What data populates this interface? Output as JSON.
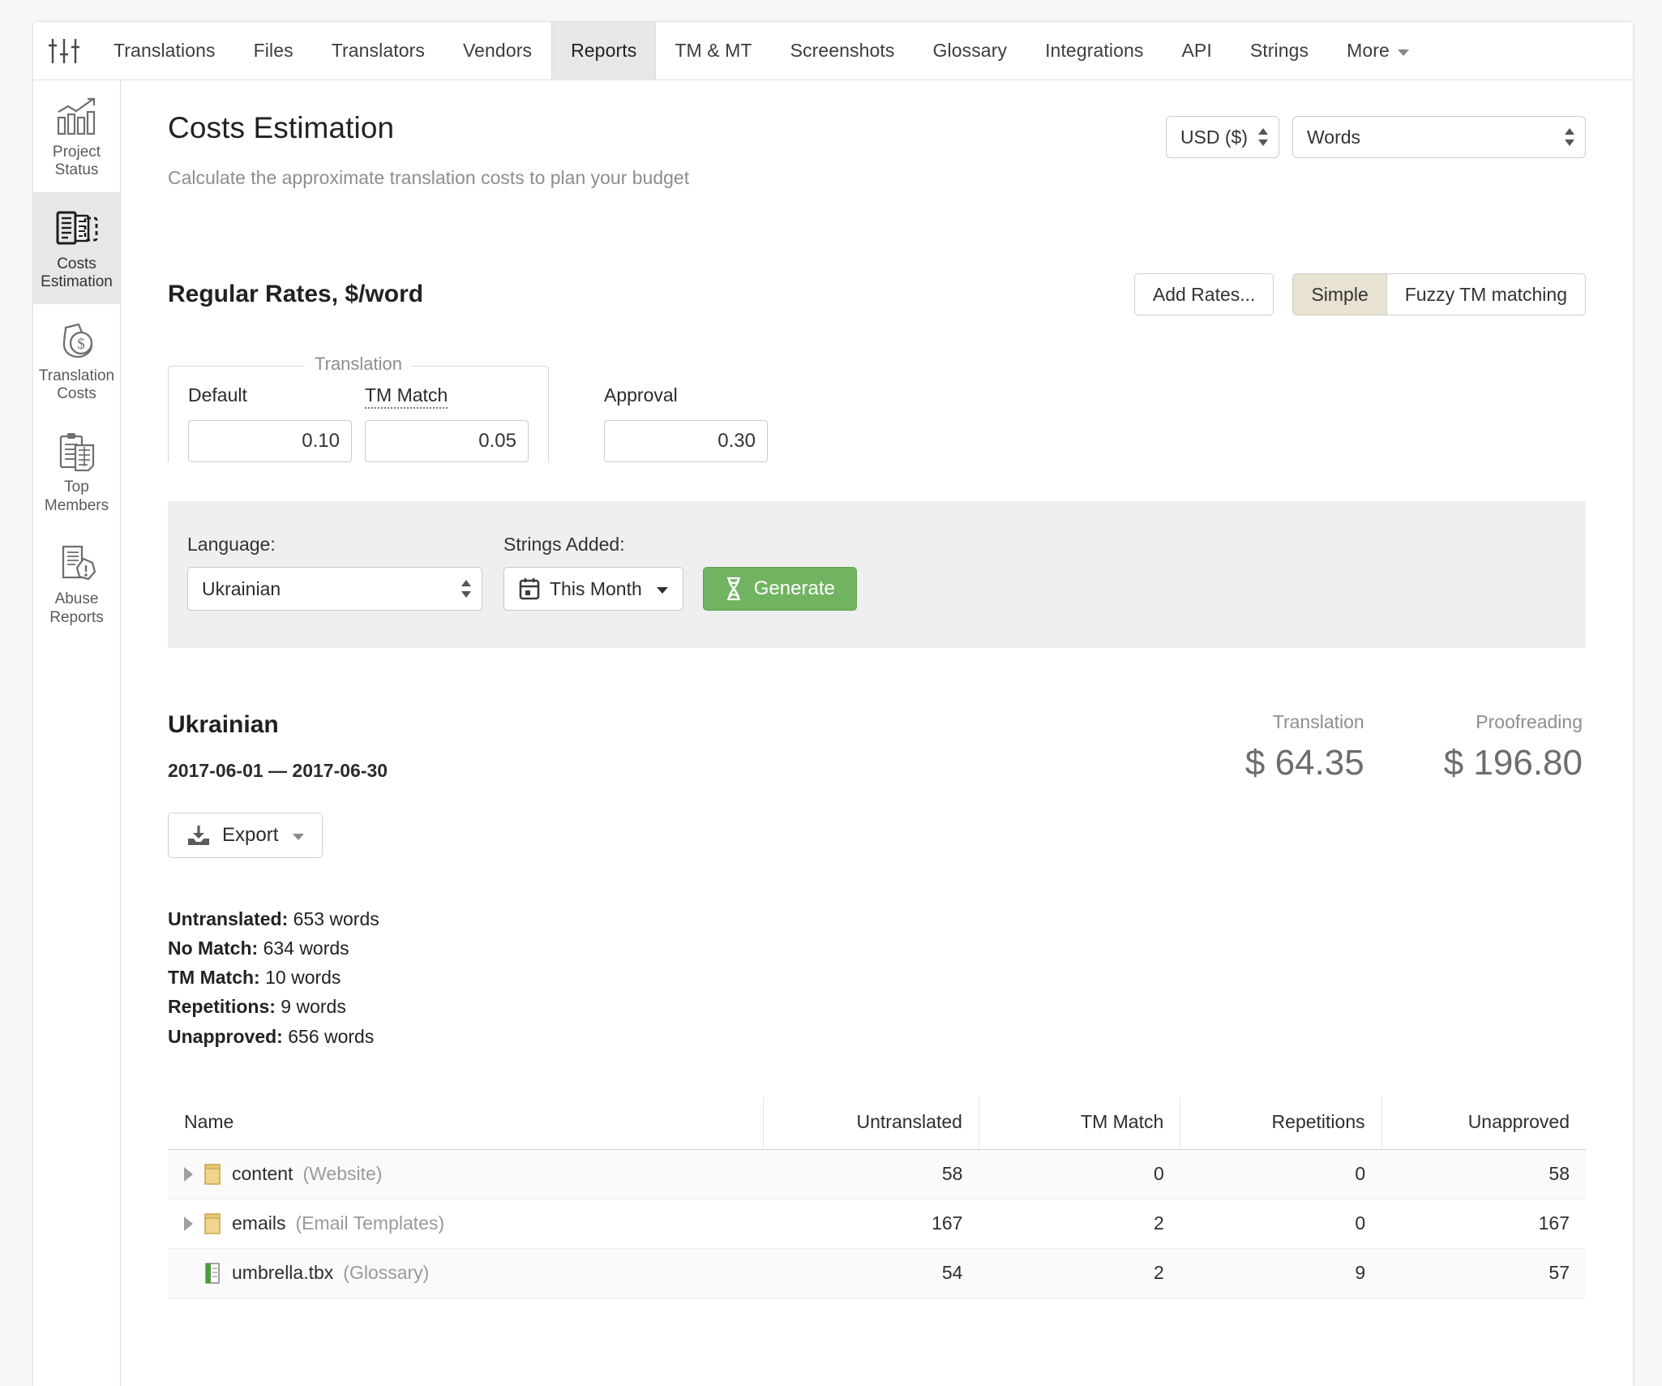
{
  "nav": {
    "logo_icon": "sliders-icon",
    "items": [
      {
        "label": "Translations",
        "active": false
      },
      {
        "label": "Files",
        "active": false
      },
      {
        "label": "Translators",
        "active": false
      },
      {
        "label": "Vendors",
        "active": false
      },
      {
        "label": "Reports",
        "active": true
      },
      {
        "label": "TM & MT",
        "active": false
      },
      {
        "label": "Screenshots",
        "active": false
      },
      {
        "label": "Glossary",
        "active": false
      },
      {
        "label": "Integrations",
        "active": false
      },
      {
        "label": "API",
        "active": false
      },
      {
        "label": "Strings",
        "active": false
      }
    ],
    "more_label": "More"
  },
  "sidebar": {
    "items": [
      {
        "label_1": "Project",
        "label_2": "Status",
        "icon": "bar-chart-growth-icon",
        "active": false
      },
      {
        "label_1": "Costs",
        "label_2": "Estimation",
        "icon": "documents-estimate-icon",
        "active": true
      },
      {
        "label_1": "Translation",
        "label_2": "Costs",
        "icon": "money-bag-dollar-icon",
        "active": false
      },
      {
        "label_1": "Top",
        "label_2": "Members",
        "icon": "clipboard-table-icon",
        "active": false
      },
      {
        "label_1": "Abuse",
        "label_2": "Reports",
        "icon": "document-warning-icon",
        "active": false
      }
    ]
  },
  "header": {
    "title": "Costs Estimation",
    "subtitle": "Calculate the approximate translation costs to plan your budget",
    "currency_value": "USD ($)",
    "unit_value": "Words"
  },
  "rates": {
    "section_title": "Regular Rates, $/word",
    "add_rates_label": "Add Rates...",
    "mode_simple_label": "Simple",
    "mode_fuzzy_label": "Fuzzy TM matching",
    "mode_active": "Simple",
    "fieldset_legend": "Translation",
    "fields": [
      {
        "label": "Default",
        "value": "0.10",
        "dotted": false,
        "in_fieldset": true
      },
      {
        "label": "TM Match",
        "value": "0.05",
        "dotted": true,
        "in_fieldset": true
      },
      {
        "label": "Approval",
        "value": "0.30",
        "dotted": false,
        "in_fieldset": false
      }
    ]
  },
  "filters": {
    "language_label": "Language:",
    "language_value": "Ukrainian",
    "strings_added_label": "Strings Added:",
    "strings_added_value": "This Month",
    "calendar_icon": "calendar-icon",
    "generate_label": "Generate",
    "generate_icon": "hourglass-icon",
    "generate_color": "#72b362"
  },
  "results": {
    "language": "Ukrainian",
    "date_range": "2017-06-01 — 2017-06-30",
    "export_label": "Export",
    "export_icon": "download-inbox-icon",
    "totals": [
      {
        "label": "Translation",
        "value": "$ 64.35"
      },
      {
        "label": "Proofreading",
        "value": "$ 196.80"
      }
    ],
    "stats": [
      {
        "label": "Untranslated:",
        "value": "653 words"
      },
      {
        "label": "No Match:",
        "value": "634 words"
      },
      {
        "label": "TM Match:",
        "value": "10 words"
      },
      {
        "label": "Repetitions:",
        "value": "9 words"
      },
      {
        "label": "Unapproved:",
        "value": "656 words"
      }
    ]
  },
  "table": {
    "columns": [
      "Name",
      "Untranslated",
      "TM Match",
      "Repetitions",
      "Unapproved"
    ],
    "rows": [
      {
        "name": "content",
        "kind": "(Website)",
        "icon": "folder-icon",
        "expandable": true,
        "untranslated": "58",
        "tm_match": "0",
        "repetitions": "0",
        "unapproved": "58"
      },
      {
        "name": "emails",
        "kind": "(Email Templates)",
        "icon": "folder-icon",
        "expandable": true,
        "untranslated": "167",
        "tm_match": "2",
        "repetitions": "0",
        "unapproved": "167"
      },
      {
        "name": "umbrella.tbx",
        "kind": "(Glossary)",
        "icon": "glossary-file-icon",
        "expandable": false,
        "untranslated": "54",
        "tm_match": "2",
        "repetitions": "9",
        "unapproved": "57"
      }
    ]
  }
}
